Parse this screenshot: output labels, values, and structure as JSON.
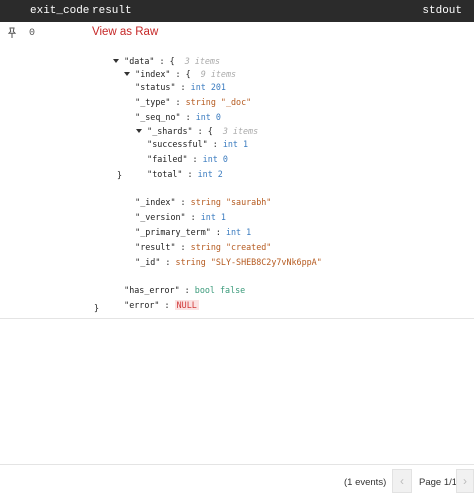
{
  "header": {
    "exit_code": "exit_code",
    "result": "result",
    "stdout": "stdout"
  },
  "row": {
    "pin_icon": "pin-icon",
    "exit_code": "0",
    "view_raw": "View as Raw"
  },
  "tree": {
    "data_key": "\"data\"",
    "data_meta": "3 items",
    "index_key": "\"index\"",
    "index_meta": "9 items",
    "status_key": "\"status\"",
    "status_type": "int",
    "status_val": "201",
    "type_key": "\"_type\"",
    "type_type": "string",
    "type_val": "\"_doc\"",
    "seqno_key": "\"_seq_no\"",
    "seqno_type": "int",
    "seqno_val": "0",
    "shards_key": "\"_shards\"",
    "shards_meta": "3 items",
    "successful_key": "\"successful\"",
    "successful_type": "int",
    "successful_val": "1",
    "failed_key": "\"failed\"",
    "failed_type": "int",
    "failed_val": "0",
    "total_key": "\"total\"",
    "total_type": "int",
    "total_val": "2",
    "index2_key": "\"_index\"",
    "index2_type": "string",
    "index2_val": "\"saurabh\"",
    "version_key": "\"_version\"",
    "version_type": "int",
    "version_val": "1",
    "primary_key": "\"_primary_term\"",
    "primary_type": "int",
    "primary_val": "1",
    "result_key": "\"result\"",
    "result_type": "string",
    "result_val": "\"created\"",
    "id_key": "\"_id\"",
    "id_type": "string",
    "id_val": "\"SLY-SHEB8C2y7vNk6ppA\"",
    "has_error_key": "\"has_error\"",
    "has_error_type": "bool",
    "has_error_val": "false",
    "error_key": "\"error\"",
    "error_val": "NULL"
  },
  "footer": {
    "events": "(1 events)",
    "page": "Page 1/1",
    "prev": "‹",
    "next": "›"
  }
}
